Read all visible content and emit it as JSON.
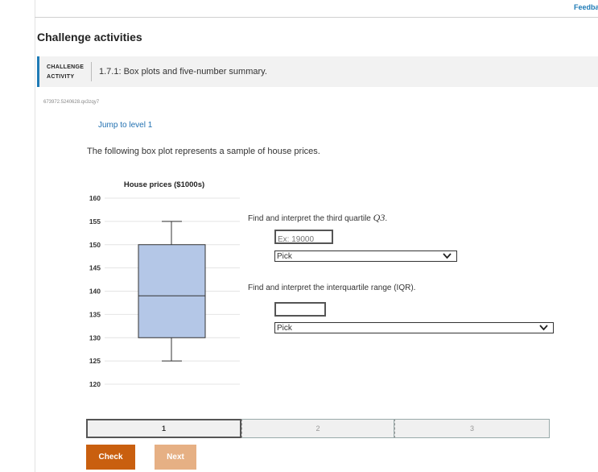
{
  "header": {
    "feedback_label": "Feedba"
  },
  "section": {
    "heading": "Challenge activities"
  },
  "activity": {
    "tag_line1": "CHALLENGE",
    "tag_line2": "ACTIVITY",
    "title": "1.7.1: Box plots and five-number summary.",
    "id": "673972.5240628.qx3zqy7"
  },
  "jump_link": "Jump to level 1",
  "prompt": "The following box plot represents a sample of house prices.",
  "chart_data": {
    "type": "boxplot",
    "title": "House prices ($1000s)",
    "ylim": [
      120,
      160
    ],
    "y_ticks": [
      160,
      155,
      150,
      145,
      140,
      135,
      130,
      125,
      120
    ],
    "grid": true,
    "box": {
      "min": 125,
      "q1": 130,
      "median": 139,
      "q3": 150,
      "max": 155
    },
    "box_color": "#b4c7e7"
  },
  "questions": [
    {
      "text_prefix": "Find and interpret the third quartile ",
      "text_var": "Q3",
      "text_suffix": ".",
      "input_placeholder": "Ex: 19000",
      "select_value": "Pick"
    },
    {
      "text": "Find and interpret the interquartile range (IQR).",
      "input_value": "",
      "select_value": "Pick"
    }
  ],
  "levels": [
    "1",
    "2",
    "3"
  ],
  "buttons": {
    "check": "Check",
    "next": "Next"
  },
  "colors": {
    "accent": "#1f7bb6",
    "check": "#c95f0f",
    "next": "#e6b084"
  }
}
